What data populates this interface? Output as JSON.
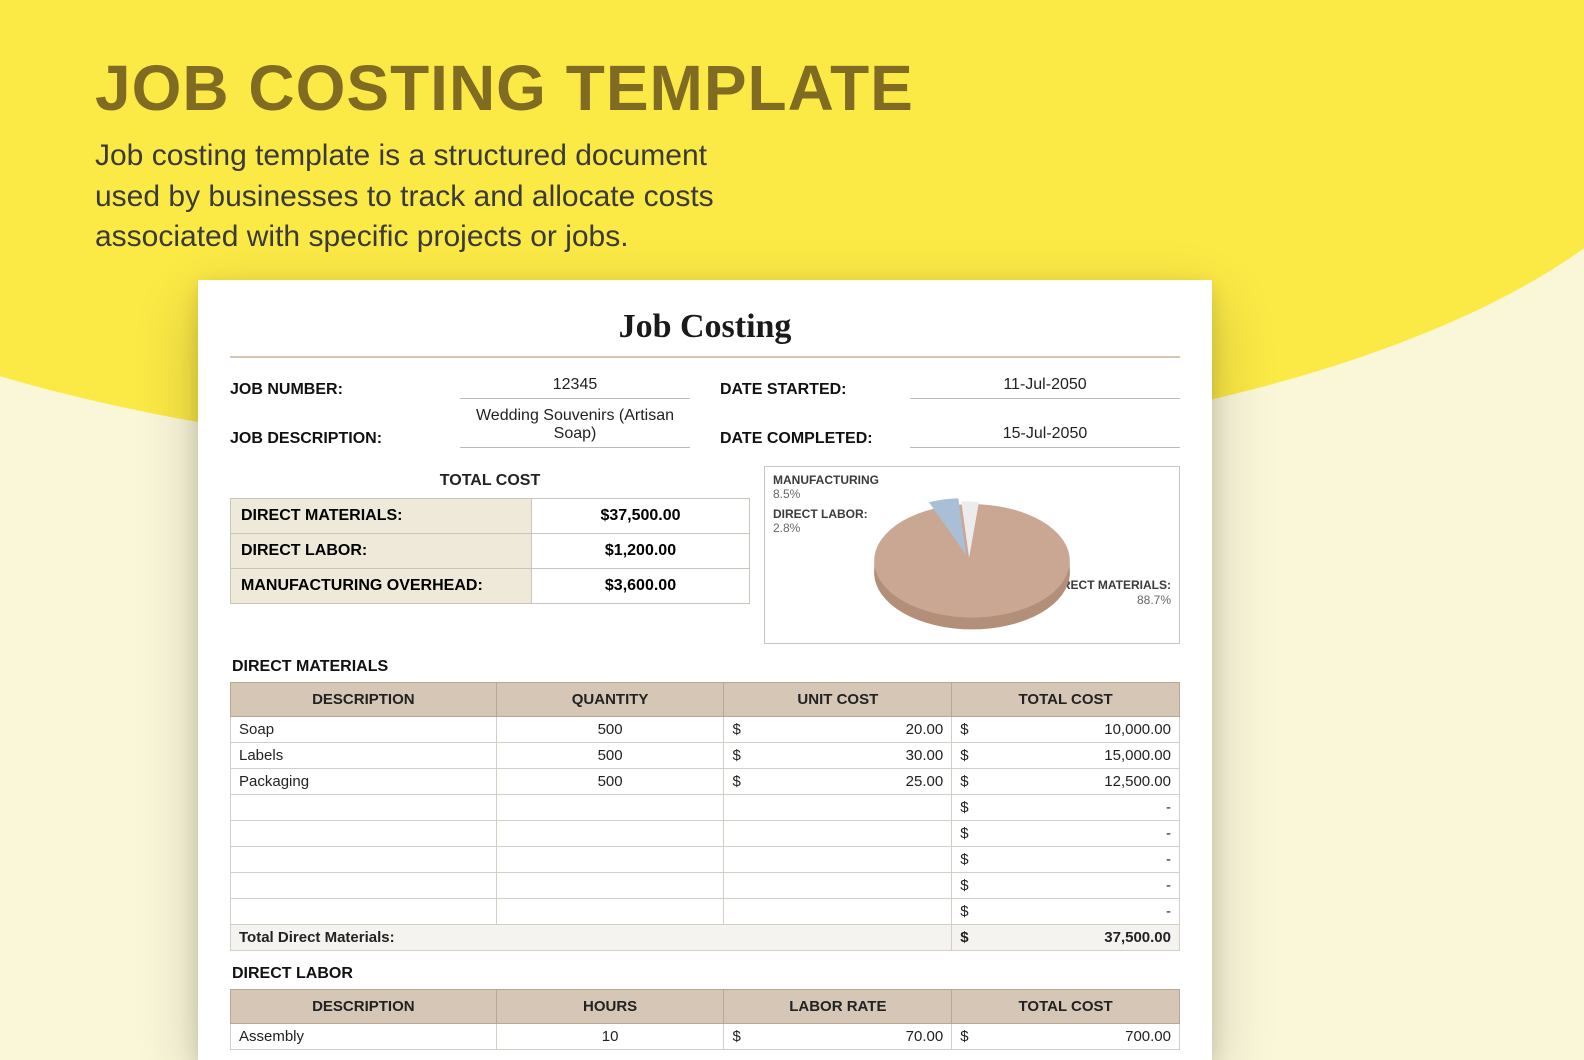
{
  "hero": {
    "title": "JOB COSTING TEMPLATE",
    "subtitle": "Job costing template is a structured document used by businesses to track and allocate costs associated with specific projects or jobs."
  },
  "doc": {
    "title": "Job Costing",
    "meta": {
      "job_number_label": "JOB NUMBER:",
      "job_number_value": "12345",
      "date_started_label": "DATE STARTED:",
      "date_started_value": "11-Jul-2050",
      "job_desc_label": "JOB DESCRIPTION:",
      "job_desc_value": "Wedding Souvenirs (Artisan Soap)",
      "date_completed_label": "DATE COMPLETED:",
      "date_completed_value": "15-Jul-2050"
    },
    "summary_header": "TOTAL COST",
    "summary": {
      "dm_label": "DIRECT MATERIALS:",
      "dm_value": "$37,500.00",
      "dl_label": "DIRECT LABOR:",
      "dl_value": "$1,200.00",
      "mo_label": "MANUFACTURING OVERHEAD:",
      "mo_value": "$3,600.00"
    },
    "chart_labels": {
      "manufacturing_name": "MANUFACTURING",
      "manufacturing_pct": "8.5%",
      "direct_labor_name": "DIRECT LABOR:",
      "direct_labor_pct": "2.8%",
      "direct_materials_name": "DIRECT MATERIALS:",
      "direct_materials_pct": "88.7%"
    },
    "direct_materials_title": "DIRECT MATERIALS",
    "direct_materials_cols": {
      "desc": "DESCRIPTION",
      "qty": "QUANTITY",
      "unit": "UNIT COST",
      "total": "TOTAL COST"
    },
    "direct_materials_rows": [
      {
        "desc": "Soap",
        "qty": "500",
        "unit": "20.00",
        "total": "10,000.00"
      },
      {
        "desc": "Labels",
        "qty": "500",
        "unit": "30.00",
        "total": "15,000.00"
      },
      {
        "desc": "Packaging",
        "qty": "500",
        "unit": "25.00",
        "total": "12,500.00"
      },
      {
        "desc": "",
        "qty": "",
        "unit": "",
        "total": "-"
      },
      {
        "desc": "",
        "qty": "",
        "unit": "",
        "total": "-"
      },
      {
        "desc": "",
        "qty": "",
        "unit": "",
        "total": "-"
      },
      {
        "desc": "",
        "qty": "",
        "unit": "",
        "total": "-"
      },
      {
        "desc": "",
        "qty": "",
        "unit": "",
        "total": "-"
      }
    ],
    "direct_materials_total_label": "Total Direct Materials:",
    "direct_materials_total_value": "37,500.00",
    "direct_labor_title": "DIRECT LABOR",
    "direct_labor_cols": {
      "desc": "DESCRIPTION",
      "hours": "HOURS",
      "rate": "LABOR RATE",
      "total": "TOTAL COST"
    },
    "direct_labor_rows": [
      {
        "desc": "Assembly",
        "hours": "10",
        "rate": "70.00",
        "total": "700.00"
      }
    ]
  },
  "chart_data": {
    "type": "pie",
    "title": "",
    "series": [
      {
        "name": "DIRECT MATERIALS",
        "value": 37500.0,
        "pct": 88.7,
        "color": "#c9a792"
      },
      {
        "name": "MANUFACTURING",
        "value": 3600.0,
        "pct": 8.5,
        "color": "#a9bfd6"
      },
      {
        "name": "DIRECT LABOR",
        "value": 1200.0,
        "pct": 2.8,
        "color": "#ececec"
      }
    ]
  },
  "colors": {
    "accent_yellow": "#fbe946",
    "bg_cream": "#faf7d9",
    "title_olive": "#7f6c22",
    "table_header": "#d6c6b5",
    "summary_label_bg": "#efe9d9"
  }
}
